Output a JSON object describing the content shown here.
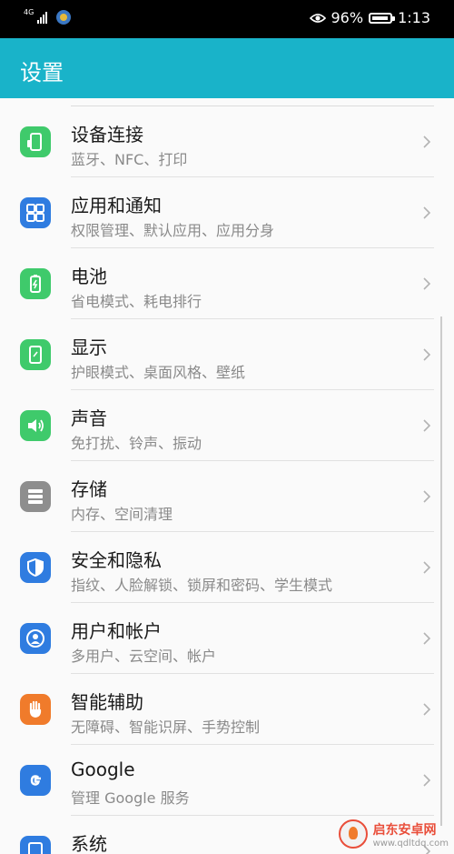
{
  "status_bar": {
    "network": "4G",
    "battery_percent": "96%",
    "time": "1:13",
    "icons": [
      "signal-icon",
      "app-notification-icon",
      "eye-comfort-icon",
      "battery-icon"
    ]
  },
  "app_bar": {
    "title": "设置"
  },
  "settings": [
    {
      "title": "设备连接",
      "subtitle": "蓝牙、NFC、打印",
      "icon": "device-connection-icon",
      "color": "#3fca6b"
    },
    {
      "title": "应用和通知",
      "subtitle": "权限管理、默认应用、应用分身",
      "icon": "apps-grid-icon",
      "color": "#2f7ce0"
    },
    {
      "title": "电池",
      "subtitle": "省电模式、耗电排行",
      "icon": "battery-icon",
      "color": "#3fca6b"
    },
    {
      "title": "显示",
      "subtitle": "护眼模式、桌面风格、壁纸",
      "icon": "display-icon",
      "color": "#3fca6b"
    },
    {
      "title": "声音",
      "subtitle": "免打扰、铃声、振动",
      "icon": "sound-icon",
      "color": "#3fca6b"
    },
    {
      "title": "存储",
      "subtitle": "内存、空间清理",
      "icon": "storage-icon",
      "color": "#8e8e8e"
    },
    {
      "title": "安全和隐私",
      "subtitle": "指纹、人脸解锁、锁屏和密码、学生模式",
      "icon": "shield-icon",
      "color": "#2f7ce0"
    },
    {
      "title": "用户和帐户",
      "subtitle": "多用户、云空间、帐户",
      "icon": "user-account-icon",
      "color": "#2f7ce0"
    },
    {
      "title": "智能辅助",
      "subtitle": "无障碍、智能识屏、手势控制",
      "icon": "hand-icon",
      "color": "#f07b2b"
    },
    {
      "title": "Google",
      "subtitle": "管理 Google 服务",
      "icon": "google-icon",
      "color": "#2f7ce0"
    },
    {
      "title": "系统",
      "subtitle": "",
      "icon": "system-icon",
      "color": "#2f7ce0"
    }
  ],
  "watermark": {
    "name": "启东安卓网",
    "url": "www.qdltdq.com"
  }
}
